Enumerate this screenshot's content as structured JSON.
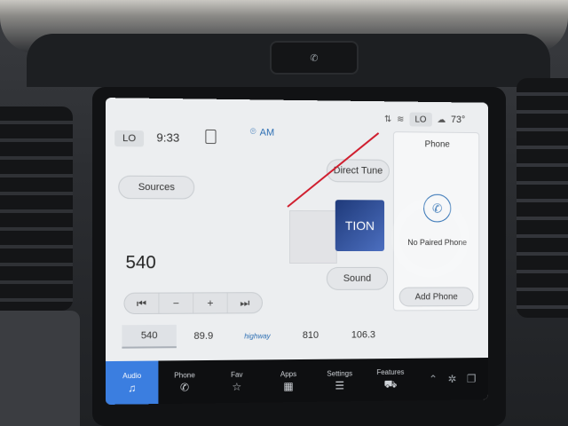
{
  "status": {
    "lo_label": "LO",
    "time": "9:33",
    "lo_label_right": "LO",
    "temperature": "73°"
  },
  "radio": {
    "band": "AM",
    "frequency": "540",
    "sources_label": "Sources",
    "direct_tune_label": "Direct Tune",
    "sound_label": "Sound",
    "presets": [
      "540",
      "89.9",
      "",
      "810",
      "106.3"
    ],
    "preset_logo": "highway",
    "transport": [
      "⏮",
      "−",
      "+",
      "⏭"
    ],
    "artwork_text": "TION"
  },
  "phone": {
    "title": "Phone",
    "status": "No Paired Phone",
    "add_label": "Add Phone"
  },
  "nav": {
    "items": [
      {
        "label": "Audio",
        "icon": "♫"
      },
      {
        "label": "Phone",
        "icon": "✆"
      },
      {
        "label": "Fav",
        "icon": "☆"
      },
      {
        "label": "Apps",
        "icon": "▦"
      },
      {
        "label": "Settings",
        "icon": "☰"
      },
      {
        "label": "Features",
        "icon": "⛟"
      }
    ]
  },
  "colors": {
    "accent": "#3b7ee0",
    "band_text": "#2d6fb3"
  }
}
